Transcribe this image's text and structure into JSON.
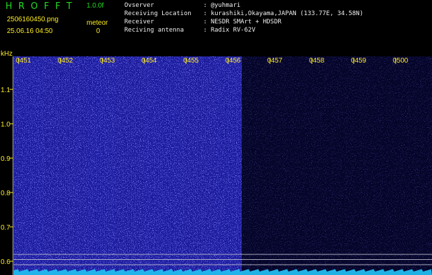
{
  "app": {
    "title": "HROFFT",
    "version": "1.0.0f"
  },
  "capture": {
    "file_name": "2506160450.png",
    "datetime": "25.06.16 04:50",
    "counter_label": "meteor",
    "counter_value": "0"
  },
  "station_info": [
    {
      "label": "Ovserver",
      "value": ": @yuhmari"
    },
    {
      "label": "Receiving Location",
      "value": ": kurashiki,Okayama,JAPAN (133.77E, 34.58N)"
    },
    {
      "label": "Receiver",
      "value": ": NESDR SMArt + HDSDR"
    },
    {
      "label": "Reciving antenna",
      "value": ": Radix RV-62V"
    }
  ],
  "chart_data": {
    "type": "heatmap",
    "y_unit": "kHz",
    "x_ticks": [
      "0451",
      "0452",
      "0453",
      "0454",
      "0455",
      "0456",
      "0457",
      "0458",
      "0459",
      "0500"
    ],
    "y_ticks": [
      "1.1",
      "1.0",
      "0.9",
      "0.8",
      "0.7",
      "0.6"
    ],
    "y_tick_values": [
      1.1,
      1.0,
      0.9,
      0.8,
      0.7,
      0.6
    ],
    "reference_lines_khz": [
      0.62,
      0.605,
      0.59
    ],
    "colors": {
      "background": "#000000",
      "signal_active": "#1a1a9a",
      "signal_quiet": "#05052a",
      "tick_label": "#ffee22",
      "axis_line": "#cccccc",
      "noise_trace": "#22bbee"
    }
  }
}
